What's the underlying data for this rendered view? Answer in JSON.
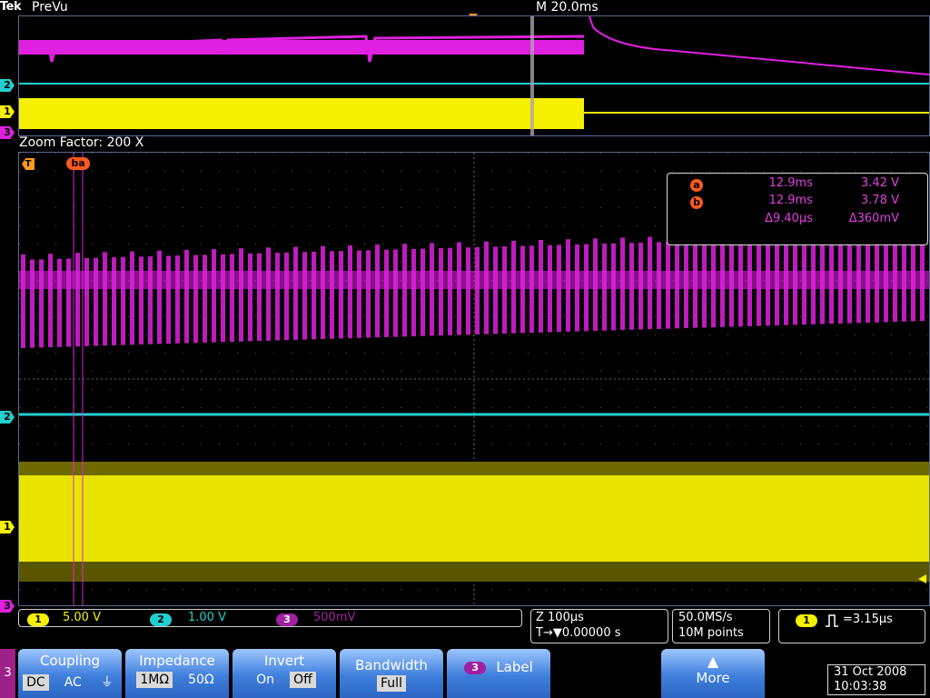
{
  "header": {
    "brand": "Tek",
    "mode": "PreVu",
    "timebase": "M 20.0ms"
  },
  "preview": {
    "trigger_marker": "T",
    "cursor_b": "b",
    "cursor_a": "a"
  },
  "zoom": {
    "label": "Zoom Factor: 200 X",
    "trigger_marker": "T",
    "cursor_ba": "ba"
  },
  "channels": {
    "ch1": {
      "number": "1",
      "color": "#f5f000"
    },
    "ch2": {
      "number": "2",
      "color": "#20d0d0"
    },
    "ch3": {
      "number": "3",
      "color": "#e020e0"
    }
  },
  "cursor_readout": {
    "a": {
      "label": "a",
      "time": "12.9ms",
      "voltage": "3.42 V"
    },
    "b": {
      "label": "b",
      "time": "12.9ms",
      "voltage": "3.78 V"
    },
    "delta": {
      "time": "Δ9.40µs",
      "voltage": "Δ360mV"
    }
  },
  "status": {
    "ch1_scale": "5.00 V",
    "ch2_scale": "1.00 V",
    "ch3_scale": "500mV",
    "zoom_scale": "Z 100µs",
    "trigger_position": "T→▼0.00000 s",
    "sample_rate": "50.0MS/s",
    "record_length": "10M points",
    "trigger_source": "1",
    "trigger_value": "=3.15µs"
  },
  "menu": {
    "channel_tab": "3",
    "coupling": {
      "title": "Coupling",
      "options": [
        "DC",
        "AC",
        "⏚"
      ]
    },
    "impedance": {
      "title": "Impedance",
      "options": [
        "1MΩ",
        "50Ω"
      ]
    },
    "invert": {
      "title": "Invert",
      "options": [
        "On",
        "Off"
      ]
    },
    "bandwidth": {
      "title": "Bandwidth",
      "value": "Full"
    },
    "label": {
      "badge": "3",
      "title": "Label"
    },
    "more": {
      "arrow": "▲",
      "title": "More"
    }
  },
  "datetime": {
    "date": "31 Oct  2008",
    "time": "10:03:38"
  }
}
